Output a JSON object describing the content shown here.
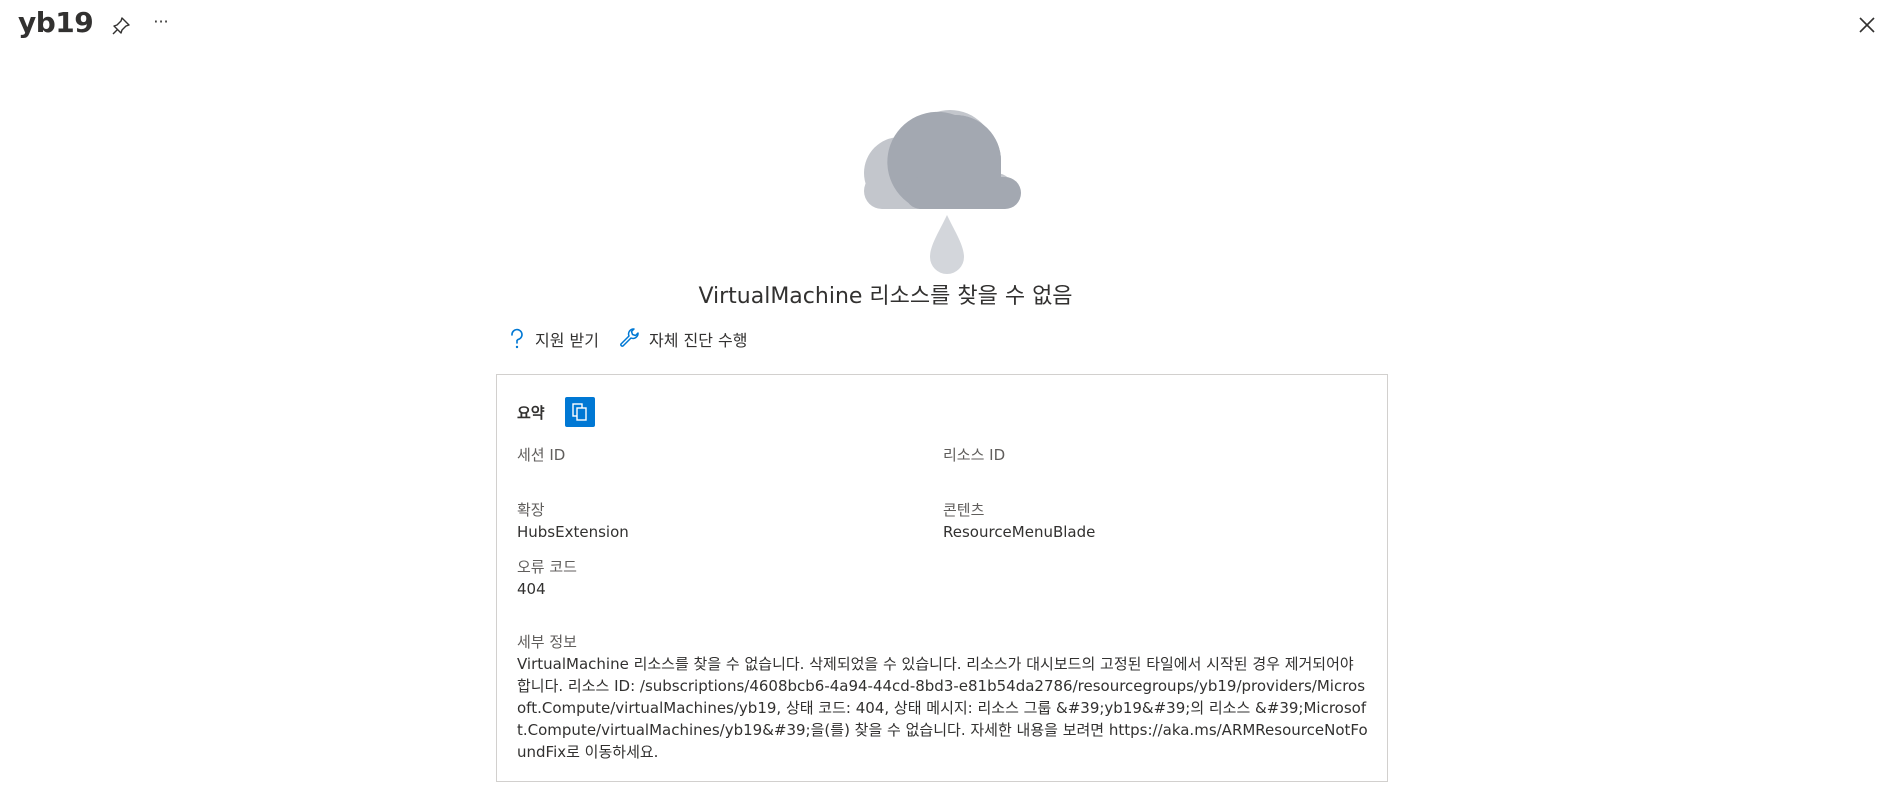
{
  "header": {
    "title": "yb19",
    "more_label": "···"
  },
  "error": {
    "title": "VirtualMachine 리소스를 찾을 수 없음"
  },
  "actions": {
    "support_label": "지원 받기",
    "diagnostics_label": "자체 진단 수행"
  },
  "summary": {
    "label": "요약",
    "session_id_label": "세션 ID",
    "session_id_value": "",
    "resource_id_label": "리소스 ID",
    "resource_id_value": "",
    "extension_label": "확장",
    "extension_value": "HubsExtension",
    "content_label": "콘텐츠",
    "content_value": "ResourceMenuBlade",
    "error_code_label": "오류 코드",
    "error_code_value": "404",
    "details_label": "세부 정보",
    "details_value": "VirtualMachine 리소스를 찾을 수 없습니다. 삭제되었을 수 있습니다. 리소스가 대시보드의 고정된 타일에서 시작된 경우 제거되어야 합니다. 리소스 ID: /subscriptions/4608bcb6-4a94-44cd-8bd3-e81b54da2786/resourcegroups/yb19/providers/Microsoft.Compute/virtualMachines/yb19, 상태 코드: 404, 상태 메시지: 리소스 그룹 &#39;yb19&#39;의 리소스 &#39;Microsoft.Compute/virtualMachines/yb19&#39;을(를) 찾을 수 없습니다. 자세한 내용을 보려면 https://aka.ms/ARMResourceNotFoundFix로 이동하세요."
  },
  "icons": {
    "pin": "pin-icon",
    "more": "more-icon",
    "close": "close-icon",
    "cloud": "cloud-rain-illustration",
    "help": "question-icon",
    "wrench": "wrench-icon",
    "copy": "copy-icon"
  },
  "colors": {
    "accent": "#0078d4",
    "cloud_dark": "#a3a8b1",
    "cloud_light": "#c3c6cc"
  }
}
